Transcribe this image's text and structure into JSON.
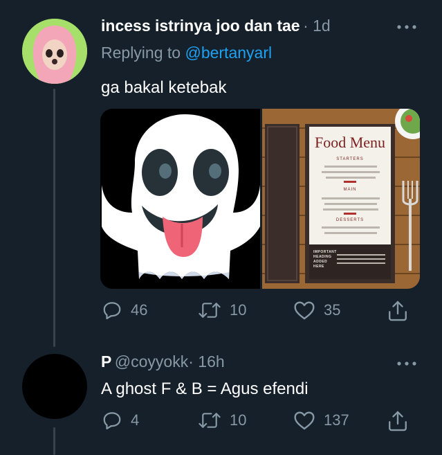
{
  "tweet1": {
    "display_name": "incess istrinya joo dan tae",
    "timestamp": "· 1d",
    "replying_prefix": "Replying to",
    "replying_handle": "@bertanyarl",
    "text": "ga bakal ketebak",
    "more_icon": "more-horizontal-icon",
    "media": [
      {
        "name": "ghost-emoji-image",
        "icon": "ghost-emoji"
      },
      {
        "name": "food-menu-image",
        "title": "Food Menu",
        "sections": [
          "STARTERS",
          "MAIN",
          "DESSERTS"
        ],
        "footer": "IMPORTANT HEADING ADDED HERE"
      }
    ],
    "actions": {
      "replies": "46",
      "retweets": "10",
      "likes": "35"
    }
  },
  "tweet2": {
    "display_name": "P",
    "handle": "@coyyokk",
    "timestamp": "· 16h",
    "text": "A ghost F & B = Agus efendi",
    "more_icon": "more-horizontal-icon",
    "actions": {
      "replies": "4",
      "retweets": "10",
      "likes": "137"
    }
  },
  "colors": {
    "background": "#15202b",
    "muted": "#8899a6",
    "link": "#1da1f2",
    "thread_line": "#38444d"
  }
}
